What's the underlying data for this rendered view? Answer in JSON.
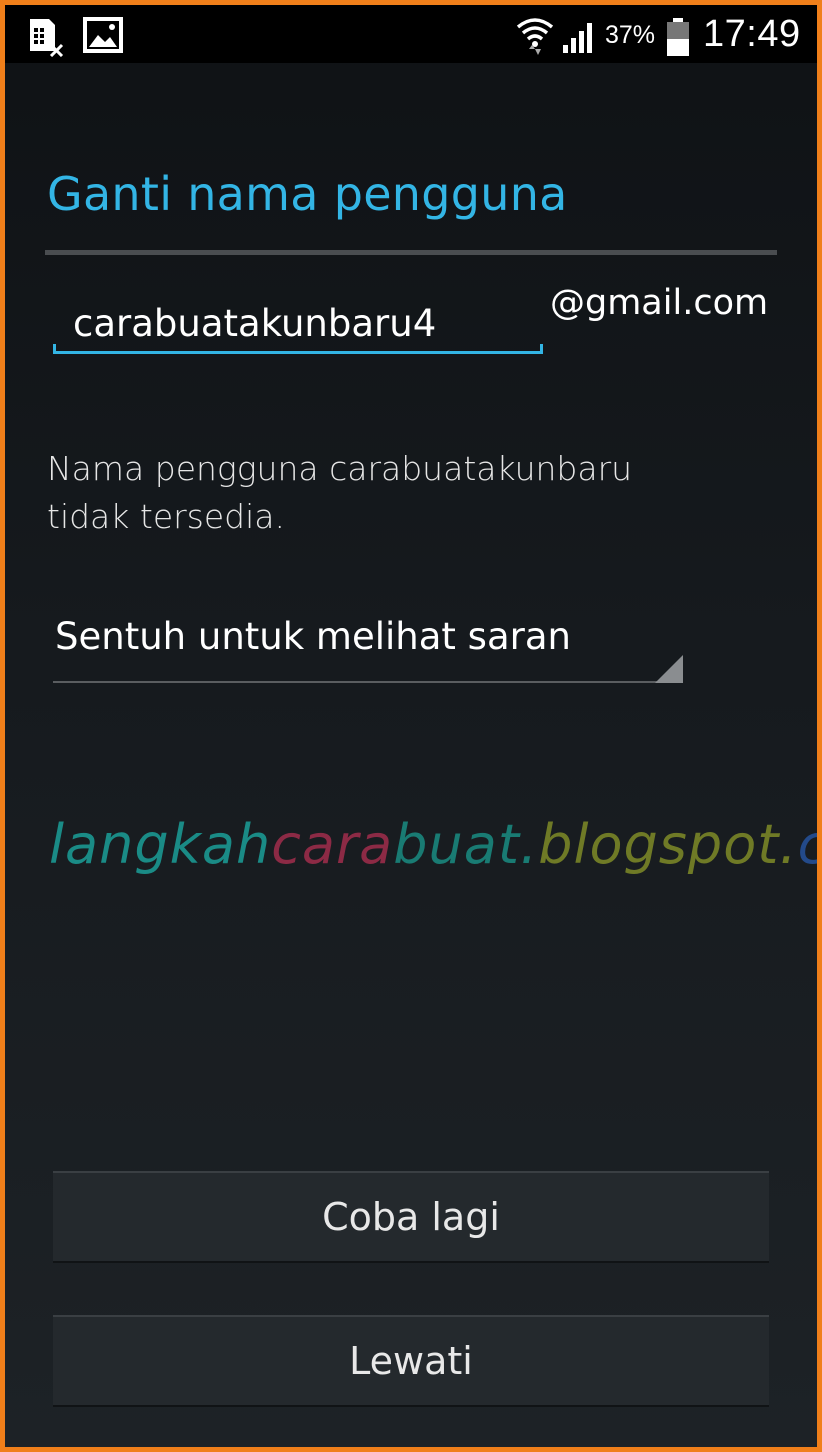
{
  "status_bar": {
    "left_icons": [
      "sim-card-icon",
      "image-icon"
    ],
    "right_icons": [
      "wifi-icon",
      "signal-icon",
      "battery-icon"
    ],
    "battery_percent": "37%",
    "time": "17:49"
  },
  "screen": {
    "title": "Ganti nama pengguna",
    "username_input_value": "carabuatakunbaru4",
    "domain_suffix": "@gmail.com",
    "message_line1": "Nama pengguna carabuatakunbaru",
    "message_line2": "tidak tersedia.",
    "suggestions_label": "Sentuh untuk melihat saran",
    "retry_button": "Coba lagi",
    "skip_button": "Lewati"
  },
  "watermark": {
    "part1": "langkah",
    "part2": "cara",
    "part3": "buat.",
    "part4": "blogspot.",
    "part5": "com"
  },
  "colors": {
    "accent": "#33b5e5",
    "frame_border": "#f07f1a",
    "background": "#15191c",
    "button_bg": "#24292d"
  }
}
